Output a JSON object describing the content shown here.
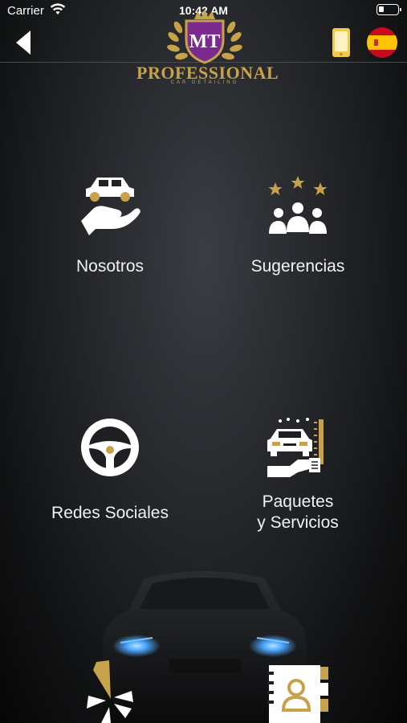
{
  "status": {
    "carrier": "Carrier",
    "time": "10:42 AM"
  },
  "brand": {
    "name": "PROFESSIONAL",
    "tagline": "CAR DETAILING",
    "emblem": "MT"
  },
  "menu": [
    {
      "label": "Nosotros",
      "icon": "hand-car-icon"
    },
    {
      "label": "Sugerencias",
      "icon": "people-stars-icon"
    },
    {
      "label": "Redes Sociales",
      "icon": "steering-wheel-icon"
    },
    {
      "label": "Paquetes\ny Servicios",
      "icon": "car-wash-icon"
    }
  ],
  "colors": {
    "gold": "#c7a24a",
    "purple": "#7b2b8f",
    "flag_red": "#c60b1e",
    "flag_yellow": "#ffc400",
    "headlight_blue": "#4aa8ff"
  }
}
